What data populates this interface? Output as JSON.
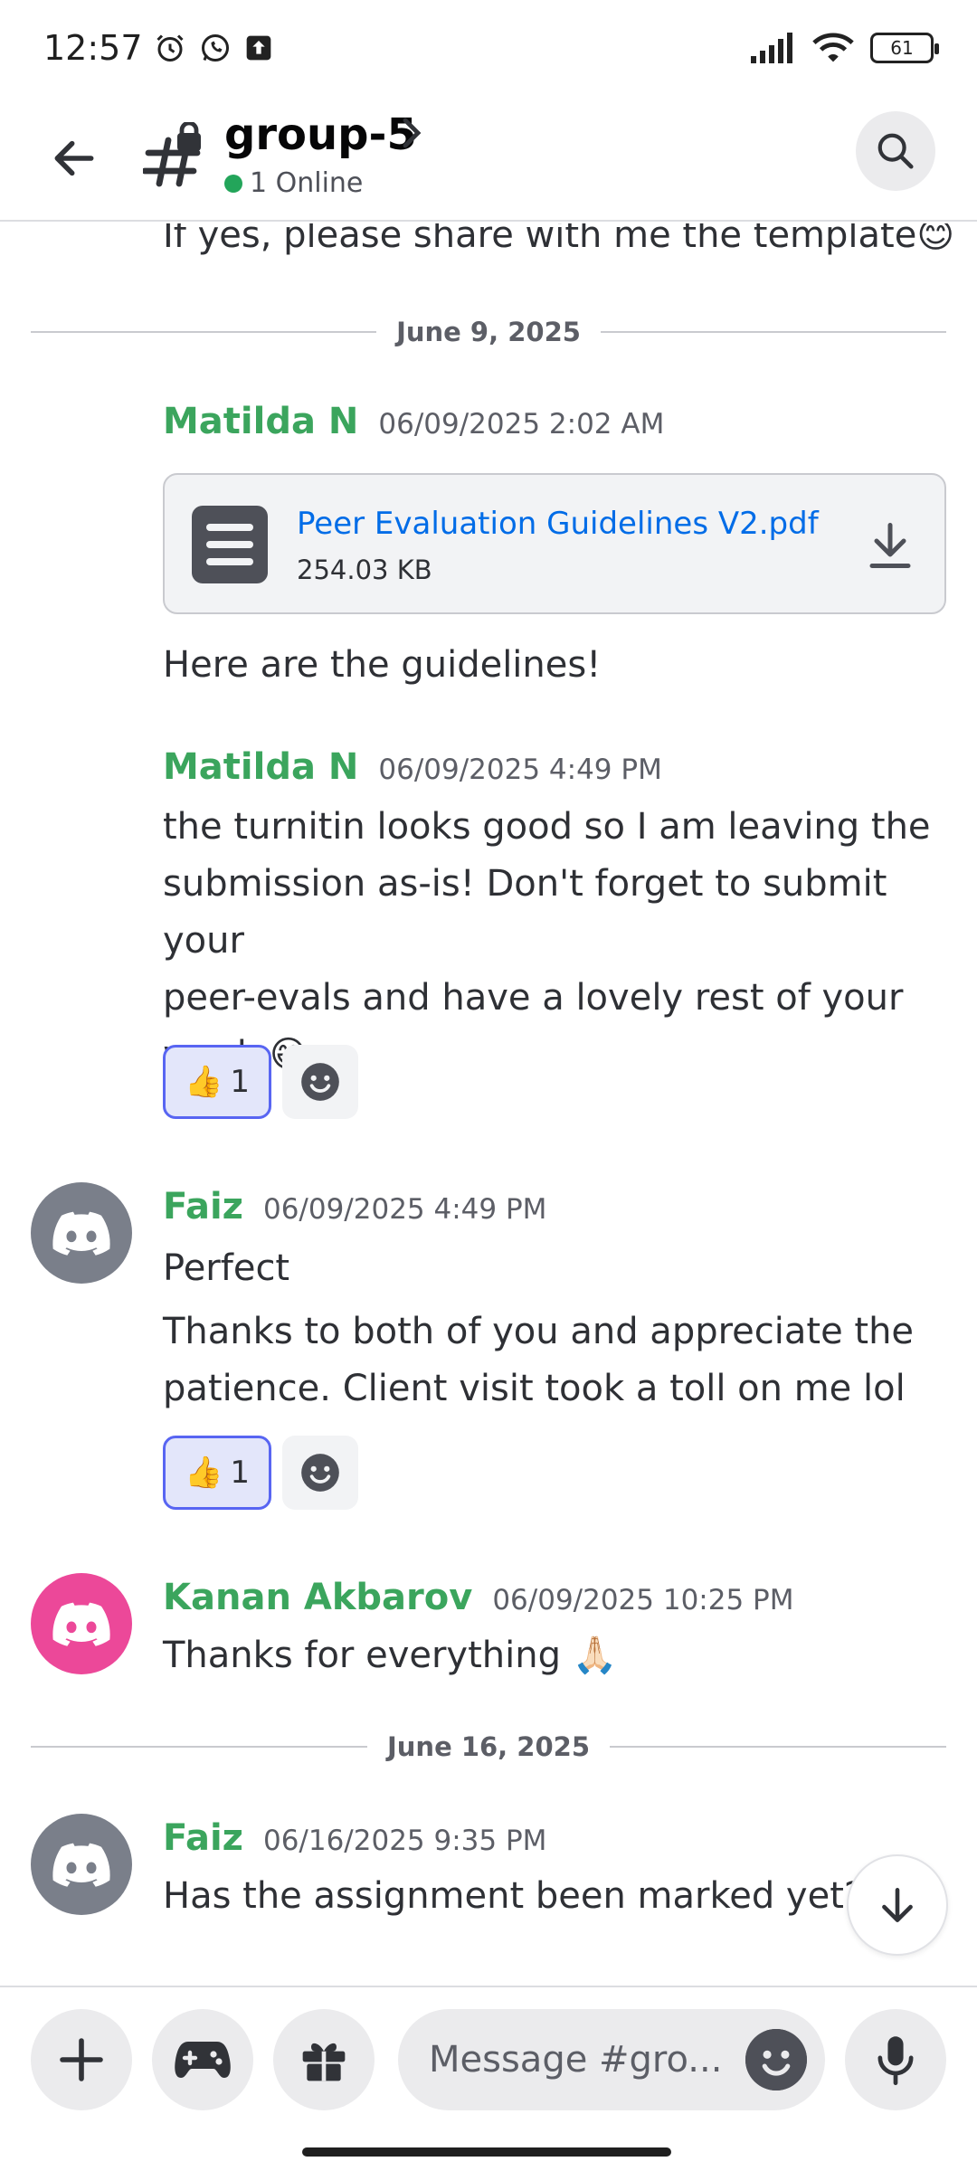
{
  "status_bar": {
    "time": "12:57",
    "battery": "61"
  },
  "header": {
    "channel": "group-5",
    "online": "1 Online"
  },
  "messages": {
    "prev_tail": "If yes, please share with me the template",
    "prev_tail_emoji": "😊",
    "divider1": "June 9, 2025",
    "m1": {
      "author": "Matilda N",
      "time": "06/09/2025 2:02 AM",
      "file_name": "Peer Evaluation Guidelines V2.pdf",
      "file_size": "254.03 KB",
      "text": "Here are the guidelines!"
    },
    "m2": {
      "author": "Matilda N",
      "time": "06/09/2025 4:49 PM",
      "line1": "the turnitin looks good so I am leaving the",
      "line2": "submission as-is! Don't forget to submit your",
      "line3": "peer-evals and have a lovely rest of your",
      "line4": "week",
      "emoji": "😄",
      "reaction_emoji": "👍",
      "reaction_count": "1"
    },
    "m3": {
      "author": "Faiz",
      "time": "06/09/2025 4:49 PM",
      "text1": "Perfect",
      "text2_line1": "Thanks to both of you and appreciate the",
      "text2_line2": "patience. Client visit took a toll on me lol",
      "reaction_emoji": "👍",
      "reaction_count": "1"
    },
    "m4": {
      "author": "Kanan Akbarov",
      "time": "06/09/2025 10:25 PM",
      "text": "Thanks for everything",
      "emoji": "🙏🏻"
    },
    "divider2": "June 16, 2025",
    "m5": {
      "author": "Faiz",
      "time": "06/16/2025 9:35 PM",
      "text": "Has the assignment been marked yet?"
    }
  },
  "composer": {
    "placeholder": "Message #gro..."
  },
  "colors": {
    "accent": "#5865f2",
    "author_green": "#3ba55d",
    "online_green": "#23a55a",
    "avatar_pink": "#ec4899",
    "avatar_grey": "#7a7f8a",
    "link_blue": "#006ce7"
  }
}
